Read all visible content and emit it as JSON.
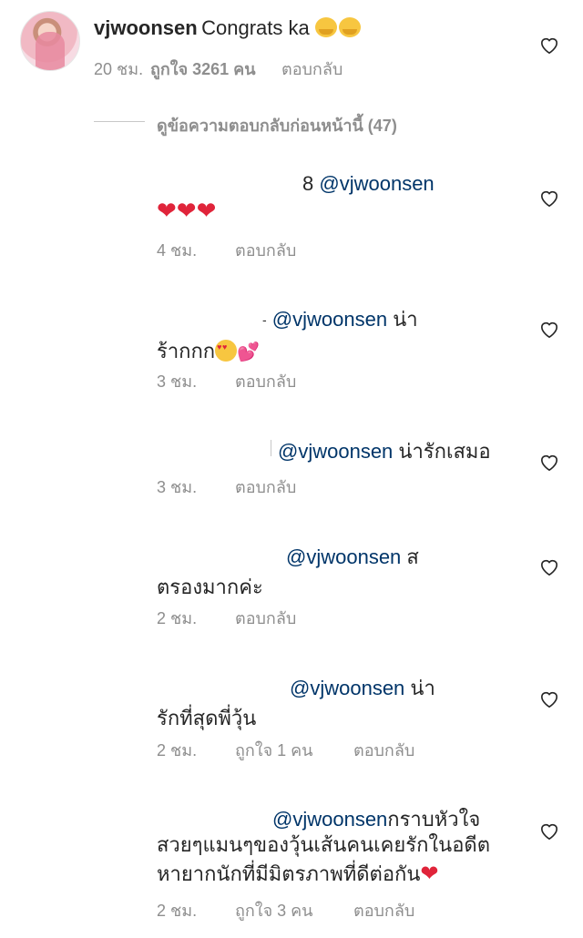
{
  "main_comment": {
    "username": "vjwoonsen",
    "text": "Congrats ka",
    "time": "20 ชม.",
    "likes": "ถูกใจ 3261 คน",
    "reply": "ตอบกลับ"
  },
  "view_previous": "ดูข้อความตอบกลับก่อนหน้านี้ (47)",
  "replies": [
    {
      "prefix": "8",
      "mention": "@vjwoonsen",
      "line1": "",
      "line2": "❤❤❤",
      "time": "4 ชม.",
      "likes": "",
      "reply": "ตอบกลับ"
    },
    {
      "prefix": "-",
      "mention": "@vjwoonsen",
      "line1": " น่า",
      "line2": "ร้ากกก",
      "time": "3 ชม.",
      "likes": "",
      "reply": "ตอบกลับ"
    },
    {
      "prefix": "",
      "mention": "@vjwoonsen",
      "line1": " น่ารักเสมอ",
      "line2": "",
      "time": "3 ชม.",
      "likes": "",
      "reply": "ตอบกลับ"
    },
    {
      "prefix": "",
      "mention": "@vjwoonsen",
      "line1": " ส",
      "line2": "ตรองมากค่ะ",
      "time": "2 ชม.",
      "likes": "",
      "reply": "ตอบกลับ"
    },
    {
      "prefix": "",
      "mention": "@vjwoonsen",
      "line1": " น่า",
      "line2": "รักที่สุดพี่วุ้น",
      "time": "2 ชม.",
      "likes": "ถูกใจ 1 คน",
      "reply": "ตอบกลับ"
    },
    {
      "prefix": "",
      "mention": "@vjwoonsen",
      "line1": "กราบหัวใจ",
      "line2": "สวยๆแมนๆของวุ้นเส้นคนเคยรักในอดีต",
      "line3": "หายากนักที่มีมิตรภาพที่ดีต่อกัน",
      "time": "2 ชม.",
      "likes": "ถูกใจ 3 คน",
      "reply": "ตอบกลับ"
    }
  ],
  "icons": {
    "like": "heart-outline-icon"
  },
  "colors": {
    "mention": "#003569",
    "meta": "#8e8e8e",
    "heart": "#e0243a"
  }
}
